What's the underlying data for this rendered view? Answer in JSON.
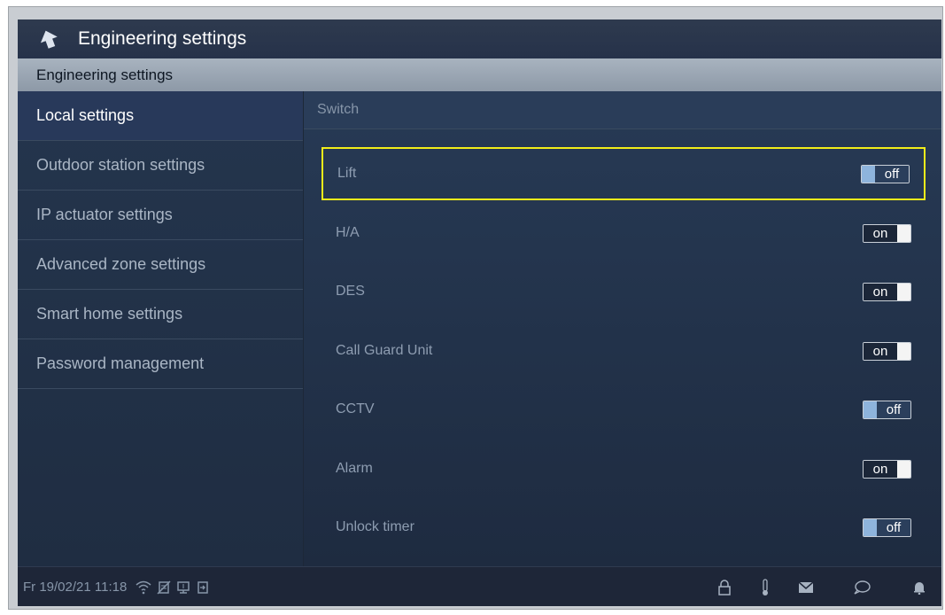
{
  "header": {
    "title": "Engineering settings"
  },
  "section": {
    "title": "Engineering settings"
  },
  "sidebar": {
    "items": [
      {
        "label": "Local settings"
      },
      {
        "label": "Outdoor station settings"
      },
      {
        "label": "IP actuator settings"
      },
      {
        "label": "Advanced zone settings"
      },
      {
        "label": "Smart home settings"
      },
      {
        "label": "Password management"
      }
    ]
  },
  "content": {
    "group_title": "Switch",
    "switches": [
      {
        "label": "Lift",
        "state": "off"
      },
      {
        "label": "H/A",
        "state": "on"
      },
      {
        "label": "DES",
        "state": "on"
      },
      {
        "label": "Call Guard Unit",
        "state": "on"
      },
      {
        "label": "CCTV",
        "state": "off"
      },
      {
        "label": "Alarm",
        "state": "on"
      },
      {
        "label": "Unlock timer",
        "state": "off"
      }
    ]
  },
  "status": {
    "datetime": "Fr 19/02/21  11:18",
    "left_icons": [
      "wifi-icon",
      "no-disturb-icon",
      "monitor-icon",
      "door-icon"
    ],
    "right_icons": [
      "lock-icon",
      "thermometer-icon",
      "mail-icon",
      "chat-icon",
      "bell-icon"
    ]
  },
  "colors": {
    "highlight": "#f2ed1a",
    "background": "#1d2838",
    "section_header": "#a8b3bf",
    "toggle_off_knob": "#8eb4dc"
  }
}
